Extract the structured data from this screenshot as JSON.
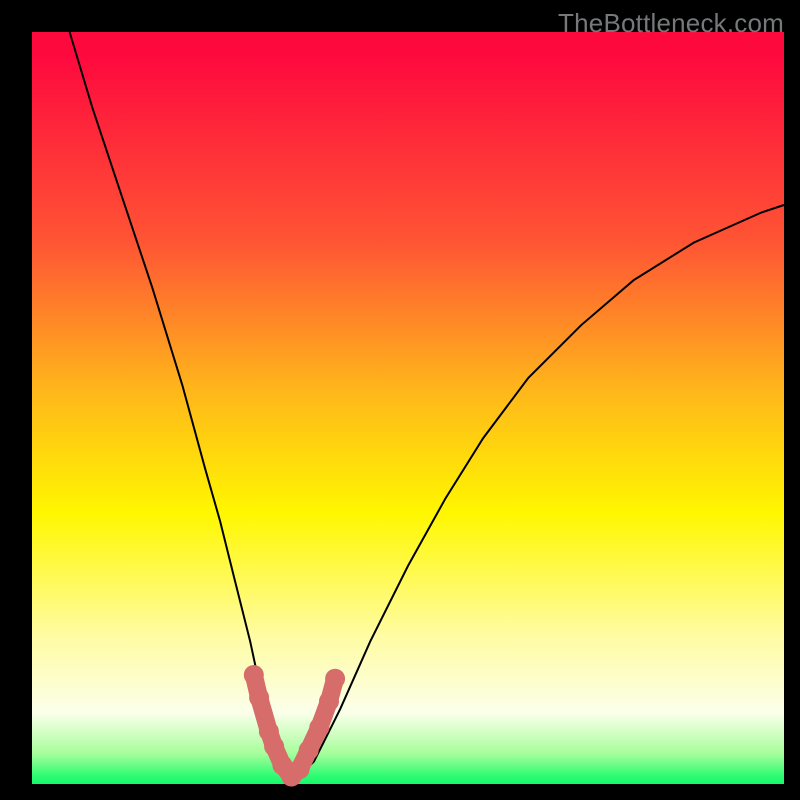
{
  "watermark": "TheBottleneck.com",
  "colors": {
    "page_bg": "#000000",
    "gradient_top": "#fe093e",
    "gradient_mid1": "#ff5534",
    "gradient_mid2": "#ffb81a",
    "gradient_mid3": "#fff700",
    "gradient_mid4": "#fffca0",
    "gradient_mid5": "#fbffea",
    "gradient_mid6": "#a5fe9a",
    "gradient_bot": "#14f96b",
    "curve": "#000000",
    "marker": "#d66d6b"
  },
  "chart_data": {
    "type": "line",
    "title": "",
    "xlabel": "",
    "ylabel": "",
    "xlim": [
      0,
      100
    ],
    "ylim": [
      0,
      100
    ],
    "grid": false,
    "legend": false,
    "annotations": [
      "TheBottleneck.com"
    ],
    "series": [
      {
        "name": "bottleneck-curve",
        "x": [
          5,
          8,
          12,
          16,
          20,
          23,
          25,
          27,
          29,
          30.5,
          32,
          33,
          34,
          35,
          36,
          37.5,
          39,
          41,
          45,
          50,
          55,
          60,
          66,
          73,
          80,
          88,
          97,
          100
        ],
        "y": [
          100,
          90,
          78,
          66,
          53,
          42,
          35,
          27,
          19,
          12,
          6,
          3,
          1.5,
          1,
          1.5,
          3,
          6,
          10,
          19,
          29,
          38,
          46,
          54,
          61,
          67,
          72,
          76,
          77
        ]
      }
    ],
    "highlight_points": {
      "name": "good-range-markers",
      "x": [
        29.5,
        30.2,
        31.5,
        32.2,
        33.3,
        34.5,
        35.6,
        36.8,
        38.2,
        39.5,
        40.3
      ],
      "y": [
        14.5,
        11.5,
        7,
        5,
        2.5,
        1,
        2,
        4.5,
        7.5,
        11,
        14
      ]
    }
  }
}
